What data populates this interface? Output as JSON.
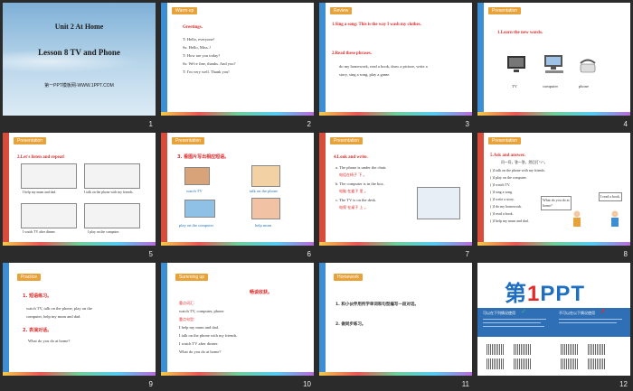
{
  "slides": [
    {
      "num": "1",
      "unit": "Unit 2  At Home",
      "lesson": "Lesson 8  TV and Phone",
      "footer": "第一PPT模板网-WWW.1PPT.COM"
    },
    {
      "num": "2",
      "tag": "Warm-up",
      "heading": "Greetings.",
      "lines": [
        "T: Hello, everyone!",
        "Ss: Hello, Miss..!",
        "T: How are you today?",
        "Ss: We're fine, thanks. And you?",
        "T: I'm very well. Thank you!"
      ]
    },
    {
      "num": "3",
      "tag": "Review",
      "item1": "1.Sing a song: This is the way I wash my clothes.",
      "item2": "2.Read these phrases.",
      "phrases": [
        "do my homework, read a book, draw a picture, write a",
        "story, sing a song, play a game."
      ]
    },
    {
      "num": "4",
      "tag": "Presentation",
      "heading": "1.Learn the new words.",
      "words": [
        "TV",
        "computer",
        "phone"
      ]
    },
    {
      "num": "5",
      "tag": "Presentation",
      "heading": "2.Let's listen and repeat!",
      "captions": [
        "I help my mum and dad.",
        "I talk on the phone with my friends.",
        "I watch TV after dinner.",
        "I play on the computer."
      ]
    },
    {
      "num": "6",
      "tag": "Presentation",
      "heading": "3. 看图片写出相应短语。",
      "labels": [
        "watch TV",
        "talk on the phone",
        "play on the computer",
        "help mum"
      ]
    },
    {
      "num": "7",
      "tag": "Presentation",
      "heading": "4.Look and write.",
      "lines": [
        "a. The phone is under the chair.",
        "电话在椅子 下 。",
        "b. The computer is in the box.",
        "电脑 在盒子 里 。",
        "c. The TV is on the desk.",
        "电视 在桌子 上 。"
      ]
    },
    {
      "num": "8",
      "tag": "Presentation",
      "heading": "5.Ask and answer.",
      "sub": "问一问，答一答，然后打\"√\"。",
      "items": [
        "( )I talk on the phone with my friends.",
        "( )I play on the computer.",
        "( )I watch TV.",
        "( )I sing a song.",
        "( )I write a story.",
        "( )I do my homework.",
        "( )I read a book.",
        "( )I help my mum and dad."
      ],
      "bubble1": "What do you do at home?",
      "bubble2": "I read a book."
    },
    {
      "num": "9",
      "tag": "Practice",
      "item1": "1. 短语练习。",
      "lines1": [
        "watch TV, talk on the phone, play on the",
        "computer, help my mum and dad."
      ],
      "item2": "2. 表演对话。",
      "line2": "What do you do at home?"
    },
    {
      "num": "10",
      "tag": "Summing up",
      "heading": "畅谈收获。",
      "sec1": "重点词汇:",
      "words": "watch TV, computer, phone",
      "sec2": "重点句型:",
      "sentences": [
        "I help my mum and dad.",
        "I talk on the phone with my friends.",
        "I watch TV after dinner.",
        "What do you do at home?"
      ]
    },
    {
      "num": "11",
      "tag": "Homework",
      "item1": "1. 和小伙伴用所学单词和句型编写一段对话。",
      "item2": "2. 做同步练习。"
    },
    {
      "num": "12",
      "logo_a": "第",
      "logo_b": "1",
      "logo_c": "PPT",
      "left_title": "可以在下列情况使用",
      "right_title": "不可以在以下情况使用"
    }
  ],
  "colors": {
    "accent_red": "#e02b2b",
    "tag_orange": "#e8a23a",
    "bg_dark": "#2b2b2b",
    "brand_blue": "#2e6fb5"
  }
}
